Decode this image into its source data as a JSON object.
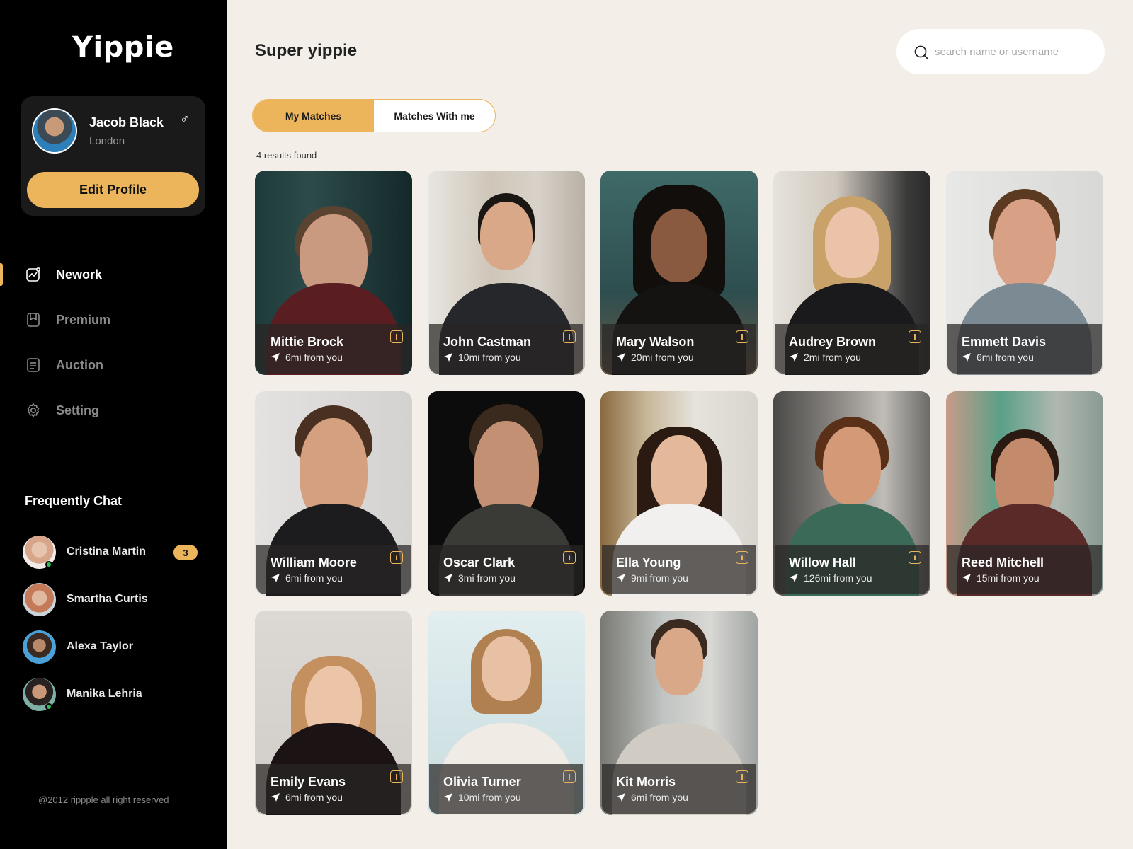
{
  "app": {
    "logo": "Yippie"
  },
  "profile": {
    "name": "Jacob Black",
    "gender_symbol": "♂",
    "city": "London",
    "edit_label": "Edit Profile"
  },
  "nav": [
    {
      "label": "Nework",
      "icon": "chart-icon",
      "active": true
    },
    {
      "label": "Premium",
      "icon": "bookmark-icon",
      "active": false
    },
    {
      "label": "Auction",
      "icon": "document-icon",
      "active": false
    },
    {
      "label": "Setting",
      "icon": "gear-icon",
      "active": false
    }
  ],
  "frequent": {
    "title": "Frequently Chat",
    "chats": [
      {
        "name": "Cristina Martin",
        "badge": "3",
        "online": true
      },
      {
        "name": "Smartha Curtis",
        "badge": "",
        "online": false
      },
      {
        "name": "Alexa Taylor",
        "badge": "",
        "online": false
      },
      {
        "name": "Manika Lehria",
        "badge": "",
        "online": true
      }
    ]
  },
  "footer": {
    "copyright": "@2012 rippple all right reserved"
  },
  "header": {
    "title": "Super yippie"
  },
  "search": {
    "placeholder": "search name or username",
    "value": ""
  },
  "tabs": [
    {
      "label": "My Matches",
      "active": true
    },
    {
      "label": "Matches With me",
      "active": false
    }
  ],
  "results_text": "4 results found",
  "matches": [
    {
      "name": "Mittie Brock",
      "distance": "6mi from you"
    },
    {
      "name": "John Castman",
      "distance": "10mi from you"
    },
    {
      "name": "Mary Walson",
      "distance": "20mi from you"
    },
    {
      "name": "Audrey Brown",
      "distance": "2mi from you"
    },
    {
      "name": "Emmett Davis",
      "distance": "6mi from you"
    },
    {
      "name": "William Moore",
      "distance": "6mi from you"
    },
    {
      "name": "Oscar Clark",
      "distance": "3mi from you"
    },
    {
      "name": "Ella Young",
      "distance": "9mi from you"
    },
    {
      "name": "Willow Hall",
      "distance": "126mi from you"
    },
    {
      "name": "Reed Mitchell",
      "distance": "15mi from you"
    },
    {
      "name": "Emily Evans",
      "distance": "6mi from you"
    },
    {
      "name": "Olivia Turner",
      "distance": "10mi from you"
    },
    {
      "name": "Kit Morris",
      "distance": "6mi from you"
    }
  ],
  "colors": {
    "accent": "#ecb55c",
    "sidebar": "#000000",
    "background": "#f3efe8",
    "online": "#2ebd59"
  }
}
